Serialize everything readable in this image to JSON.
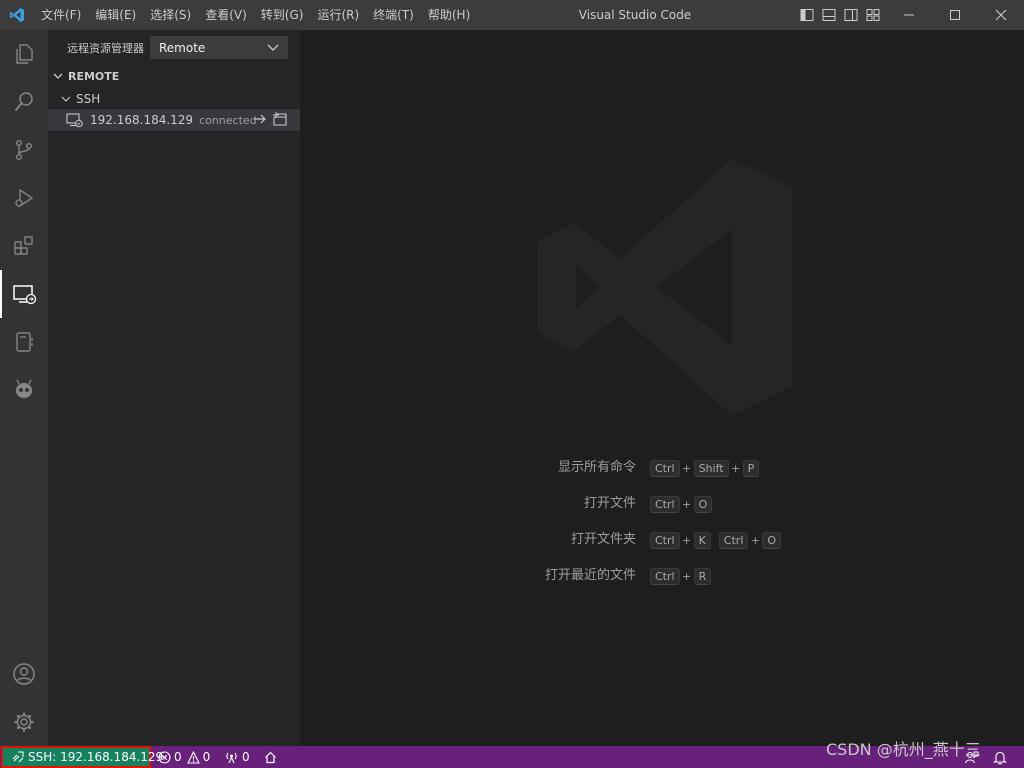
{
  "titlebar": {
    "app_icon": "vscode-logo-icon",
    "menu": [
      "文件(F)",
      "编辑(E)",
      "选择(S)",
      "查看(V)",
      "转到(G)",
      "运行(R)",
      "终端(T)",
      "帮助(H)"
    ],
    "title": "Visual Studio Code",
    "layout_icons": [
      "toggle-primary-sidebar-icon",
      "toggle-panel-icon",
      "toggle-secondary-sidebar-icon",
      "customize-layout-icon"
    ],
    "window_controls": [
      "minimize-icon",
      "maximize-icon",
      "close-icon"
    ]
  },
  "activitybar": {
    "items": [
      "explorer-icon",
      "search-icon",
      "source-control-icon",
      "run-debug-icon",
      "extensions-icon",
      "remote-explorer-icon",
      "notebook-icon",
      "platformio-icon"
    ],
    "active": "remote-explorer-icon",
    "bottom": [
      "accounts-icon",
      "manage-gear-icon"
    ]
  },
  "sidebar": {
    "title": "远程资源管理器",
    "dropdown_value": "Remote",
    "section": "REMOTE",
    "group": "SSH",
    "host": {
      "address": "192.168.184.129",
      "status": "connected"
    }
  },
  "editor": {
    "shortcuts": [
      {
        "label": "显示所有命令",
        "keys": [
          [
            "Ctrl",
            "Shift",
            "P"
          ]
        ]
      },
      {
        "label": "打开文件",
        "keys": [
          [
            "Ctrl",
            "O"
          ]
        ]
      },
      {
        "label": "打开文件夹",
        "keys": [
          [
            "Ctrl",
            "K"
          ],
          [
            "Ctrl",
            "O"
          ]
        ]
      },
      {
        "label": "打开最近的文件",
        "keys": [
          [
            "Ctrl",
            "R"
          ]
        ]
      }
    ]
  },
  "statusbar": {
    "remote": "SSH: 192.168.184.129",
    "errors": "0",
    "warnings": "0",
    "ports": "0",
    "background_color": "#68217a",
    "remote_color": "#16825d"
  },
  "overlay_text": "CSDN @杭州_燕十三"
}
